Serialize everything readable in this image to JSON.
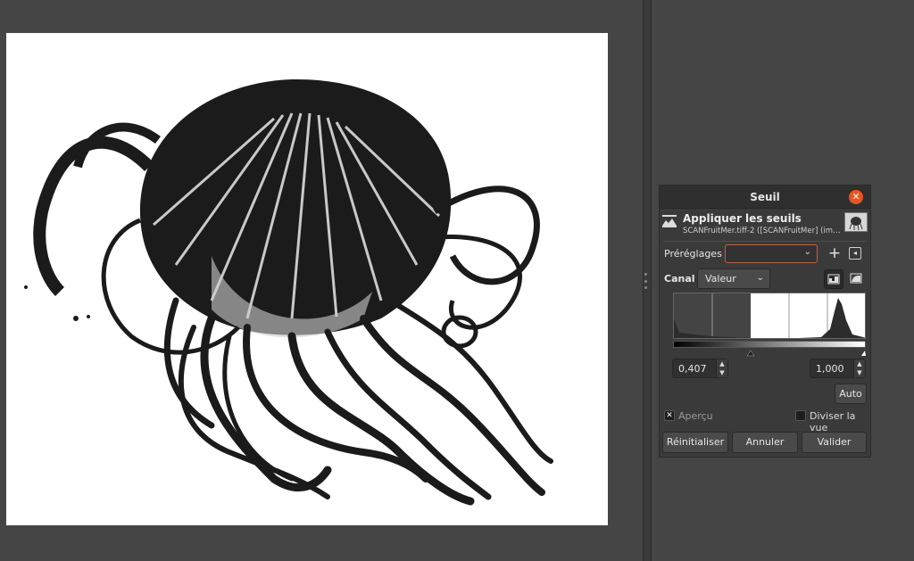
{
  "dialog": {
    "title": "Seuil",
    "close_glyph": "✕",
    "heading": "Appliquer les seuils",
    "subtitle": "SCANFruitMer.tiff-2 ([SCANFruitMer] (im…",
    "presets_label": "Préréglages :",
    "presets_value": "",
    "channel_label": "Canal :",
    "channel_value": "Valeur",
    "low_value": "0,407",
    "high_value": "1,000",
    "auto_label": "Auto",
    "preview_label": "Aperçu",
    "preview_checked": true,
    "split_label": "Diviser la vue",
    "split_checked": false,
    "reset_label": "Réinitialiser",
    "cancel_label": "Annuler",
    "ok_label": "Valider"
  },
  "icons": {
    "tool": "threshold-tool-icon",
    "add": "plus-icon",
    "menu": "preset-menu-icon",
    "linear": "linear-histogram-icon",
    "log": "log-histogram-icon",
    "close": "close-icon"
  },
  "colors": {
    "accent": "#e95420",
    "background": "#454545",
    "dialog": "#3a3a3a"
  }
}
